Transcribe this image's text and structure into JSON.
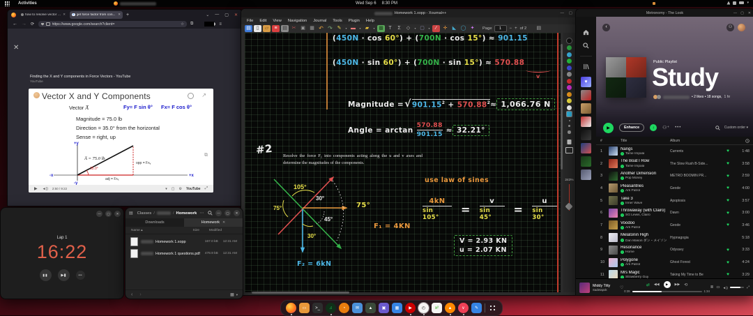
{
  "topbar": {
    "activities_label": "Activities",
    "date": "Wed Sep 6",
    "time": "8:30 PM"
  },
  "browser": {
    "tab1": "how to resolve vector int...",
    "tab2": "get force factor from con...",
    "url": "https://www.google.com/search?client=",
    "page": {
      "result_title": "Finding the X and Y components in Force Vectors - YouTube",
      "result_source": "YouTube"
    },
    "video": {
      "title": "Vector X and Y Components",
      "vector_label": "Vector",
      "vector_symbol": "A̅",
      "fy_formula": "Fy= F sin θ°",
      "fx_formula": "Fx= F cos θ°",
      "magnitude": "Magnitude = 75.0 lb",
      "direction": "Direction = 35.0° from the horizontal",
      "sense": "Sense = right, up",
      "hypotenuse_label": "A̅ = 75.0 lb",
      "angle_label": "35.0°",
      "adj_label": "adj = FAx",
      "opp_label": "opp = FAy",
      "axis_up": "+y",
      "axis_right": "+x",
      "axis_left": "-x",
      "axis_down": "-y",
      "timestamp": "2:50 / 9:22",
      "brand": "YouTube"
    }
  },
  "timer": {
    "lap_label": "Lap 1",
    "time": "16:22"
  },
  "files": {
    "breadcrumb_root": "Classes",
    "breadcrumb_current": "Homework",
    "tab_downloads": "Downloads",
    "tab_homework": "Homework",
    "col_name": "Name",
    "col_size": "Size",
    "col_modified": "Modified",
    "rows": [
      {
        "name": "Homework 1.xopp",
        "size": "167.0 kB",
        "modified": "12:31 AM"
      },
      {
        "name": "Homework 1 questions.pdf",
        "size": "478.9 kB",
        "modified": "12:31 AM"
      }
    ]
  },
  "xournal": {
    "title": "Homework 1.xopp - Xournal++",
    "menus": [
      "File",
      "Edit",
      "View",
      "Navigation",
      "Journal",
      "Tools",
      "Plugin",
      "Help"
    ],
    "page_label": "Page",
    "page_number": "1",
    "page_total": "of 2",
    "zoom_level": "243%",
    "palette": [
      "#111111",
      "#2faa44",
      "#3fb8e8",
      "#28c940",
      "#4550e6",
      "#9a9a9a",
      "#e03131",
      "#d633d6",
      "#f59f1e",
      "#f5e642",
      "#ffffff",
      "#31b5e0"
    ],
    "notes": {
      "cos_line": [
        "(",
        "450N",
        " · cos ",
        "60°",
        ") + (",
        "700N",
        " · cos ",
        "15°",
        ") ≈ ",
        "901.15"
      ],
      "sin_line": [
        "(",
        "450N",
        " · sin ",
        "60°",
        ") + (",
        "700N",
        " · sin ",
        "15°",
        ") ≈ ",
        "570.88"
      ],
      "underbrace_mark": "v",
      "magnitude": {
        "label": "Magnitude =",
        "sqrt": "√",
        "t1": "901.15",
        "sup1": "2",
        "plus": " + ",
        "t2": "570.88",
        "sup2": "2",
        "approx": " ≈ ",
        "result": "1,066.76 N"
      },
      "angle": {
        "label": "Angle = arctan",
        "num": "570.88",
        "den": "901.15",
        "approx": " ≈ ",
        "result": "32.21°"
      },
      "problem_number": "#2",
      "problem_text": "Resolve the force F₁ into components acting along the u and v axes and determine the magnitudes of the components.",
      "diagram": {
        "a105": "105°",
        "a30": "30°",
        "a75_left": "75°",
        "a45": "45°",
        "a30_low": "30°",
        "a75_right": "75°",
        "f1": "F₁ = 4KN",
        "f2": "F₂ = 6kN"
      },
      "law": {
        "heading": "use law of sines",
        "f1_num": "4kN",
        "f1_den": "sin 105°",
        "eq1": "=",
        "v_num": "v",
        "v_den": "sin 45°",
        "eq2": "=",
        "u_num": "u",
        "u_den": "sin 30°"
      },
      "result_v": "V = 2.93 KN",
      "result_u": "u = 2.07 KN"
    }
  },
  "spotify": {
    "window_title": "Metronomy - The Look",
    "playlist_type": "Public Playlist",
    "playlist_title": "Study",
    "playlist_meta": "• 2 likes • 18 songs,",
    "playlist_duration": "1 hr",
    "enhance_label": "Enhance",
    "sort_label": "Custom order",
    "col_hash": "#",
    "col_title": "Title",
    "col_album": "Album",
    "accent_green": "#1ed760",
    "tracks": [
      {
        "title": "Nangs",
        "artist": "Tame Impala",
        "album": "Currents",
        "duration": "1:48",
        "liked": true,
        "cover": [
          "#27406e",
          "#cfe0f2"
        ]
      },
      {
        "title": "The Boat I Row",
        "artist": "Tame Impala",
        "album": "The Slow Rush B-Side...",
        "duration": "3:58",
        "liked": true,
        "cover": [
          "#8e2418",
          "#e07a5a"
        ]
      },
      {
        "title": "Another Dimension",
        "artist": "Pop Money",
        "album": "METRO BOOMIN PR...",
        "duration": "2:59",
        "liked": true,
        "cover": [
          "#0d0d0d",
          "#2f6b2f"
        ]
      },
      {
        "title": "Pleasantries",
        "artist": "Ark Patrol",
        "album": "Geode",
        "duration": "4:00",
        "liked": true,
        "cover": [
          "#b59a6e",
          "#6e5836"
        ]
      },
      {
        "title": "Take 3",
        "artist": "Inner Wave",
        "album": "Apoptosis",
        "duration": "3:57",
        "liked": true,
        "cover": [
          "#70704a",
          "#3c3c2a"
        ]
      },
      {
        "title": "Throwaway (with Clairo)",
        "artist": "SG Lewis, Clairo",
        "album": "Dawn",
        "duration": "3:00",
        "liked": true,
        "cover": [
          "#7a4aa8",
          "#ef83b0"
        ]
      },
      {
        "title": "Voodoo",
        "artist": "Ark Patrol",
        "album": "Geode",
        "duration": "3:46",
        "liked": true,
        "cover": [
          "#7a5a28",
          "#c8a04a"
        ]
      },
      {
        "title": "Melatonin High",
        "artist": "Dan Mason ダン・メイソン",
        "album": "Hypnagogia",
        "duration": "5:18",
        "liked": false,
        "cover": [
          "#ececf2",
          "#bcbccb"
        ]
      },
      {
        "title": "Resonance",
        "artist": "Home",
        "album": "Odyssey",
        "duration": "3:33",
        "liked": true,
        "cover": [
          "#8a8a8a",
          "#4a4a4a"
        ]
      },
      {
        "title": "Polygone",
        "artist": "Ark Patrol",
        "album": "Ghost Forest",
        "duration": "4:24",
        "liked": true,
        "cover": [
          "#eab0cf",
          "#a9c9ea"
        ]
      },
      {
        "title": "Mrs Magic",
        "artist": "Strawberry Guy",
        "album": "Taking My Time to Be",
        "duration": "3:29",
        "liked": true,
        "cover": [
          "#bcd9ea",
          "#ead9bc"
        ]
      }
    ],
    "sidebar_covers": [
      {
        "c1": "#4a3de0",
        "c2": "#9db4ff",
        "glyph": "♥"
      },
      {
        "c1": "#8a8a8a",
        "c2": "#c02020",
        "glyph": ""
      },
      {
        "c1": "#caa06a",
        "c2": "#7a5a30",
        "glyph": ""
      },
      {
        "c1": "#c03030",
        "c2": "#f0f0f0",
        "glyph": ""
      },
      {
        "c1": "#101010",
        "c2": "#3a3a3a",
        "glyph": ""
      },
      {
        "c1": "#204080",
        "c2": "#d05050",
        "glyph": ""
      },
      {
        "c1": "#183818",
        "c2": "#2a6a2a",
        "glyph": ""
      },
      {
        "c1": "#555a70",
        "c2": "#9aa0b8",
        "glyph": ""
      }
    ],
    "collage": [
      "#9a9a9a",
      "#b03828",
      "#122812",
      "#2e2e40"
    ],
    "player": {
      "track": "Middy Titty",
      "artist": "Sadetapok",
      "elapsed": "0:39",
      "total": "1:34",
      "progress_pct": 42
    }
  },
  "dock": {
    "items": [
      {
        "name": "firefox",
        "color": "#ff7a1a",
        "glyph": "",
        "running": true,
        "active": false
      },
      {
        "name": "files",
        "color": "#e8993a",
        "glyph": "▭",
        "running": false,
        "active": false
      },
      {
        "name": "terminal",
        "color": "#2d2d2d",
        "glyph": ">_",
        "running": false,
        "active": false
      },
      {
        "name": "spotify",
        "color": "#0f2f18",
        "glyph": "♫",
        "running": true,
        "active": false
      },
      {
        "name": "blender",
        "color": "#e87d0d",
        "glyph": "◔",
        "running": false,
        "active": false
      },
      {
        "name": "mail",
        "color": "#4a90d9",
        "glyph": "✉",
        "running": false,
        "active": false
      },
      {
        "name": "photos",
        "color": "#3a4a3a",
        "glyph": "▲",
        "running": false,
        "active": false
      },
      {
        "name": "boxes",
        "color": "#6a5acd",
        "glyph": "▣",
        "running": false,
        "active": false
      },
      {
        "name": "calendar",
        "color": "#3584e4",
        "glyph": "▦",
        "running": false,
        "active": false
      },
      {
        "name": "youtube-music",
        "color": "#cc0000",
        "glyph": "▶",
        "running": true,
        "active": false
      },
      {
        "name": "clocks",
        "color": "#f6f5f4",
        "glyph": "◴",
        "running": true,
        "active": true
      },
      {
        "name": "libreoffice-calc",
        "color": "#f6f5f4",
        "glyph": "x²",
        "running": false,
        "active": false
      },
      {
        "name": "vlc",
        "color": "#ff8800",
        "glyph": "▲",
        "running": true,
        "active": false
      },
      {
        "name": "pocket",
        "color": "#ef4056",
        "glyph": "∨",
        "running": true,
        "active": false
      },
      {
        "name": "text-editor",
        "color": "#3584e4",
        "glyph": "✎",
        "running": false,
        "active": false
      }
    ]
  }
}
